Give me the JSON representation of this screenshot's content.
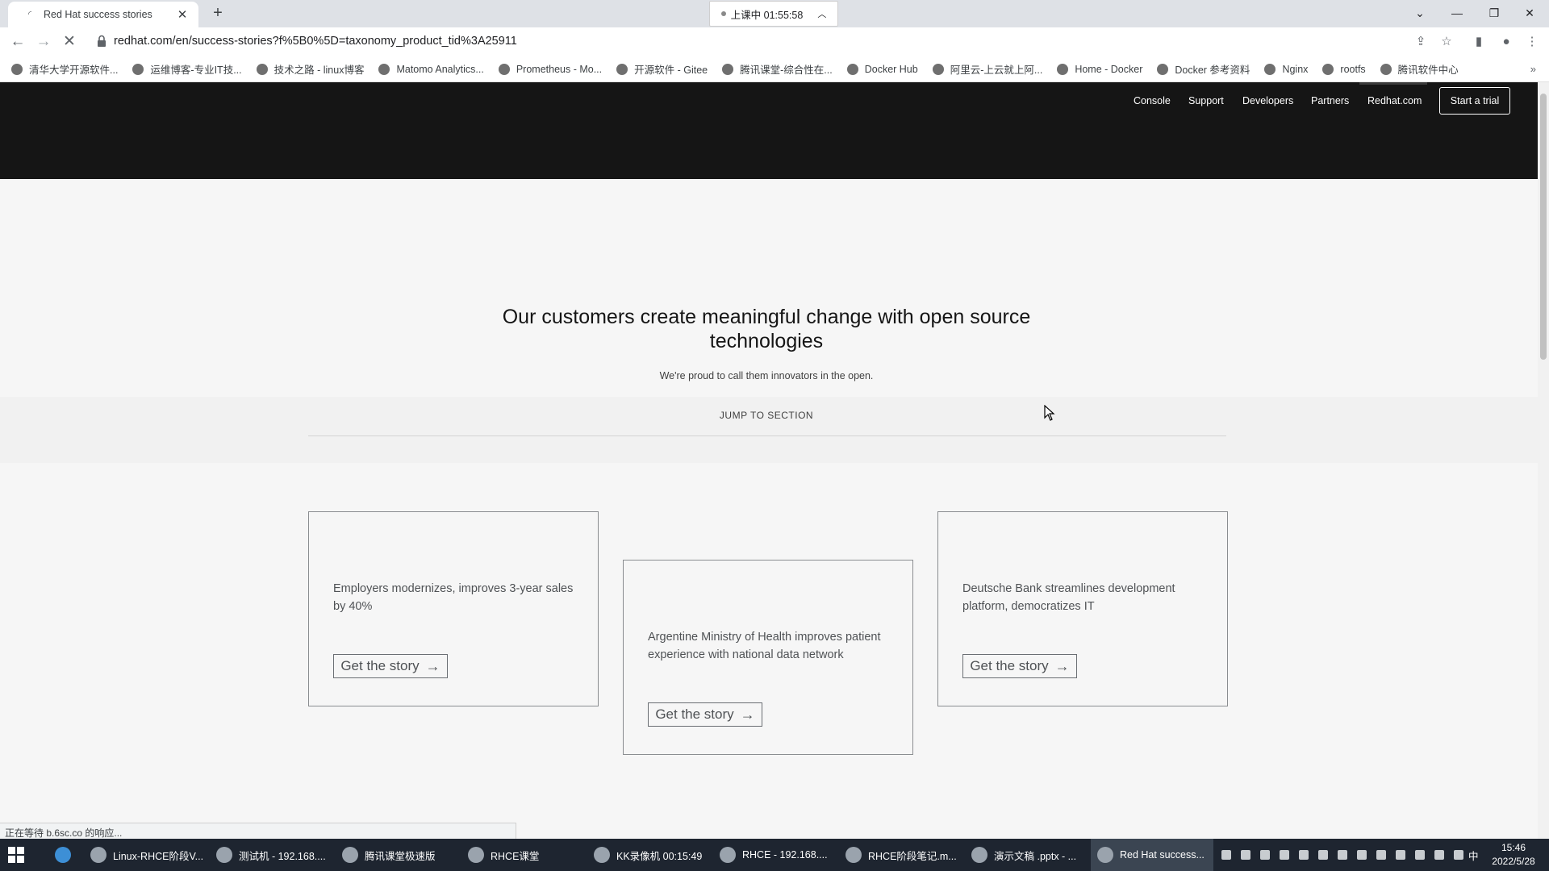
{
  "browser": {
    "tab_title": "Red Hat success stories",
    "new_tab_symbol": "+",
    "class_timer": "上课中 01:55:58",
    "url": "redhat.com/en/success-stories?f%5B0%5D=taxonomy_product_tid%3A25911",
    "bookmarks": [
      "清华大学开源软件...",
      "运维博客-专业IT技...",
      "技术之路 - linux博客",
      "Matomo Analytics...",
      "Prometheus - Mo...",
      "开源软件 - Gitee",
      "腾讯课堂-综合性在...",
      "Docker Hub",
      "阿里云-上云就上阿...",
      "Home - Docker",
      "Docker 参考资料",
      "Nginx",
      "rootfs",
      "腾讯软件中心"
    ],
    "status_text": "正在等待 b.6sc.co 的响应..."
  },
  "redhat_nav": {
    "links": [
      "Console",
      "Support",
      "Developers",
      "Partners",
      "Redhat.com"
    ],
    "trial_button": "Start a trial"
  },
  "hero": {
    "title": "Our customers create meaningful change with open source technologies",
    "subtitle": "We're proud to call them innovators in the open.",
    "jump_label": "JUMP TO SECTION"
  },
  "cards": [
    {
      "text": "Employers modernizes, improves 3-year sales by 40%",
      "button": "Get the story"
    },
    {
      "text": "Argentine Ministry of Health improves patient experience with national data network",
      "button": "Get the story"
    },
    {
      "text": "Deutsche Bank streamlines development platform, democratizes IT",
      "button": "Get the story"
    }
  ],
  "taskbar": {
    "apps": [
      "Linux-RHCE阶段V...",
      "测试机 - 192.168....",
      "腾讯课堂极速版",
      "RHCE课堂",
      "KK录像机 00:15:49",
      "RHCE - 192.168....",
      "RHCE阶段笔记.m...",
      "演示文稿 .pptx - ...",
      "Red Hat success..."
    ],
    "ime": "中",
    "time": "15:46",
    "date": "2022/5/28"
  },
  "icons": {
    "back": "arrow-left-icon",
    "forward": "arrow-right-icon",
    "reload": "close-stop-icon",
    "lock": "lock-icon",
    "share": "share-icon",
    "star": "star-icon",
    "sidepanel": "sidepanel-icon",
    "profile": "profile-icon",
    "menu": "kebab-menu-icon",
    "arrow": "arrow-right-icon"
  }
}
